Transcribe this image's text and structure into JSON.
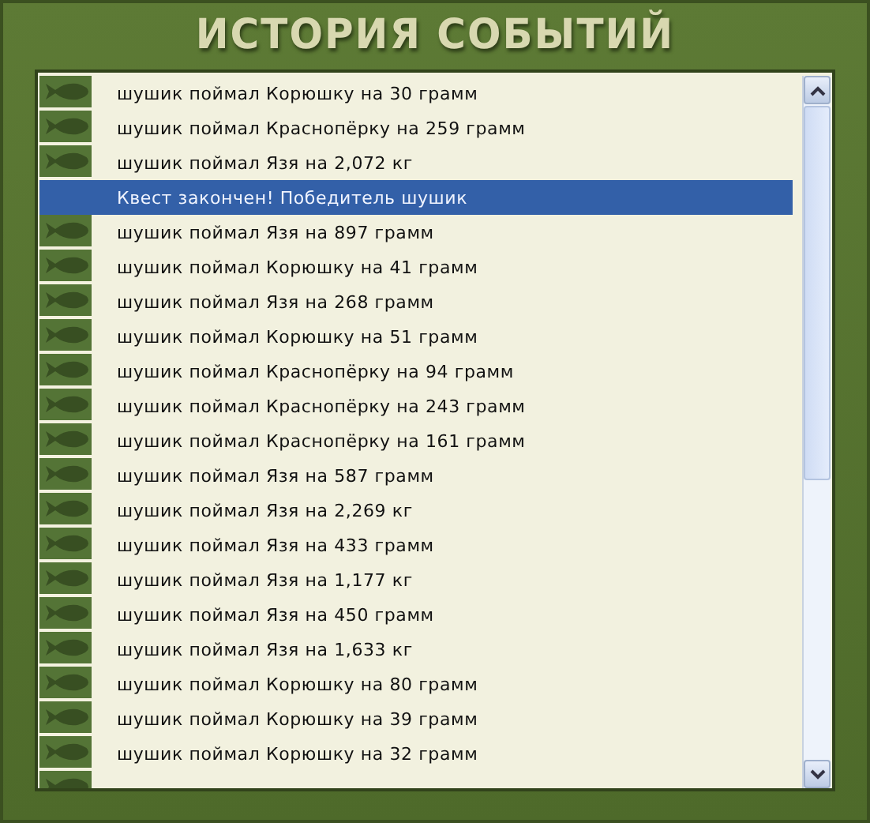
{
  "title": "ИСТОРИЯ СОБЫТИЙ",
  "events": [
    {
      "kind": "catch",
      "text": "шушик поймал Корюшку на 30 грамм",
      "selected": false
    },
    {
      "kind": "catch",
      "text": "шушик поймал Краснопёрку на 259 грамм",
      "selected": false
    },
    {
      "kind": "catch",
      "text": "шушик поймал Язя на 2,072 кг",
      "selected": false
    },
    {
      "kind": "quest",
      "text": "Квест закончен! Победитель шушик",
      "selected": true
    },
    {
      "kind": "catch",
      "text": "шушик поймал Язя на 897 грамм",
      "selected": false
    },
    {
      "kind": "catch",
      "text": "шушик поймал Корюшку на 41 грамм",
      "selected": false
    },
    {
      "kind": "catch",
      "text": "шушик поймал Язя на 268 грамм",
      "selected": false
    },
    {
      "kind": "catch",
      "text": "шушик поймал Корюшку на 51 грамм",
      "selected": false
    },
    {
      "kind": "catch",
      "text": "шушик поймал Краснопёрку на 94 грамм",
      "selected": false
    },
    {
      "kind": "catch",
      "text": "шушик поймал Краснопёрку на 243 грамм",
      "selected": false
    },
    {
      "kind": "catch",
      "text": "шушик поймал Краснопёрку на 161 грамм",
      "selected": false
    },
    {
      "kind": "catch",
      "text": "шушик поймал Язя на 587 грамм",
      "selected": false
    },
    {
      "kind": "catch",
      "text": "шушик поймал Язя на 2,269 кг",
      "selected": false
    },
    {
      "kind": "catch",
      "text": "шушик поймал Язя на 433 грамм",
      "selected": false
    },
    {
      "kind": "catch",
      "text": "шушик поймал Язя на 1,177 кг",
      "selected": false
    },
    {
      "kind": "catch",
      "text": "шушик поймал Язя на 450 грамм",
      "selected": false
    },
    {
      "kind": "catch",
      "text": "шушик поймал Язя на 1,633 кг",
      "selected": false
    },
    {
      "kind": "catch",
      "text": "шушик поймал Корюшку на 80 грамм",
      "selected": false
    },
    {
      "kind": "catch",
      "text": "шушик поймал Корюшку на 39 грамм",
      "selected": false
    },
    {
      "kind": "catch",
      "text": "шушик поймал Корюшку на 32 грамм",
      "selected": false
    },
    {
      "kind": "catch",
      "selected": false
    }
  ]
}
